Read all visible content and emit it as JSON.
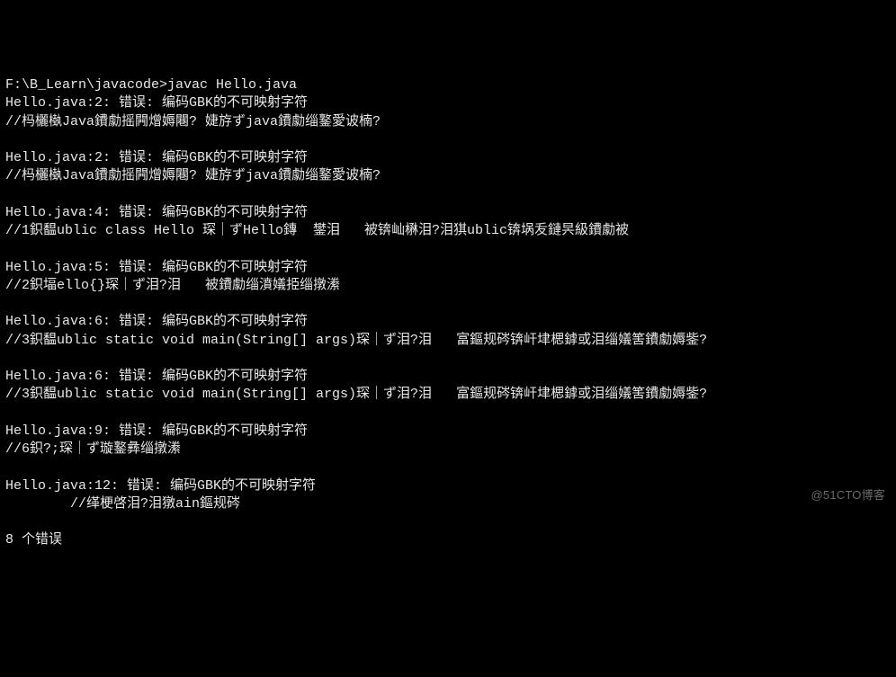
{
  "terminal": {
    "prompt": "F:\\B_Learn\\javacode>",
    "command": "javac Hello.java",
    "lines": [
      "F:\\B_Learn\\javacode>javac Hello.java",
      "Hello.java:2: 错误: 编码GBK的不可映射字符",
      "//杩欐槸Java鐨勮摇闁熷媷闀? 婕斿ずjava鐨勮缁鐜愛诐楠?",
      "",
      "Hello.java:2: 错误: 编码GBK的不可映射字符",
      "//杩欐槸Java鐨勮摇闁熷媷闀? 婕斿ずjava鐨勮缁鐜愛诐楠?",
      "",
      "Hello.java:4: 错误: 编码GBK的不可映射字符",
      "//1鉙馧ublic class Hello 琛｜ずHello鏄  鐢泪   被锛屾楙泪?泪猉ublic锛埚叐鏈昗級鐨勮被",
      "",
      "Hello.java:5: 错误: 编码GBK的不可映射字符",
      "//2鉙堛ello{}琛｜ず泪?泪   被鐨勮缁濆嬟挋缁撴潫",
      "",
      "Hello.java:6: 错误: 编码GBK的不可映射字符",
      "//3鉙馧ublic static void main(String[] args)琛｜ず泪?泪   富鏂规硶锛屽垏楒鎼或泪缁嬟筈鐨勮媷鈭?",
      "",
      "Hello.java:6: 错误: 编码GBK的不可映射字符",
      "//3鉙馧ublic static void main(String[] args)琛｜ず泪?泪   富鏂规硶锛屽垏楒鎼或泪缁嬟筈鐨勮媷鈭?",
      "",
      "Hello.java:9: 错误: 编码GBK的不可映射字符",
      "//6鉙?;琛｜ず璇鐜彝缁撴潫",
      "",
      "Hello.java:12: 错误: 编码GBK的不可映射字符",
      "        //缂梗啓泪?泪獤ain鏂规硶",
      "",
      "8 个错误"
    ]
  },
  "watermark": "@51CTO博客"
}
